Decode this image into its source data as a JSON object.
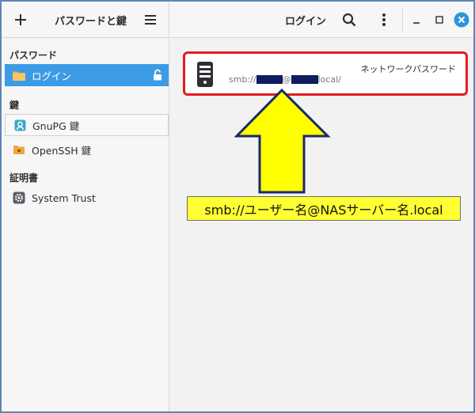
{
  "header": {
    "add_icon": "plus-icon",
    "app_title": "パスワードと鍵",
    "menu_icon": "hamburger-icon",
    "view_title": "ログイン",
    "search_icon": "search-icon",
    "more_icon": "vertical-dots-icon",
    "window_controls": [
      "minimize-icon",
      "maximize-icon",
      "close-icon"
    ]
  },
  "sidebar": {
    "sections": [
      {
        "heading": "パスワード",
        "items": [
          {
            "label": "ログイン",
            "icon": "folder-icon",
            "selected": true,
            "locked_icon": "unlocked-padlock-icon"
          }
        ]
      },
      {
        "heading": "鍵",
        "items": [
          {
            "label": "GnuPG 鍵",
            "icon": "gnupg-key-icon"
          },
          {
            "label": "OpenSSH 鍵",
            "icon": "ssh-folder-icon"
          }
        ]
      },
      {
        "heading": "証明書",
        "items": [
          {
            "label": "System Trust",
            "icon": "gear-certificate-icon"
          }
        ]
      }
    ]
  },
  "main": {
    "entry": {
      "icon": "server-icon",
      "type_label": "ネットワークパスワード",
      "uri_prefix": "smb://",
      "uri_at": "@",
      "uri_suffix": "local/"
    }
  },
  "annotation": {
    "callout_text": "smb://ユーザー名@NASサーバー名.local",
    "callout_color": "#ffff33",
    "highlight_color": "#e41b23"
  },
  "colors": {
    "accent": "#3c9be6",
    "window_close": "#2a95d8",
    "redaction": "#0d1d5e"
  }
}
